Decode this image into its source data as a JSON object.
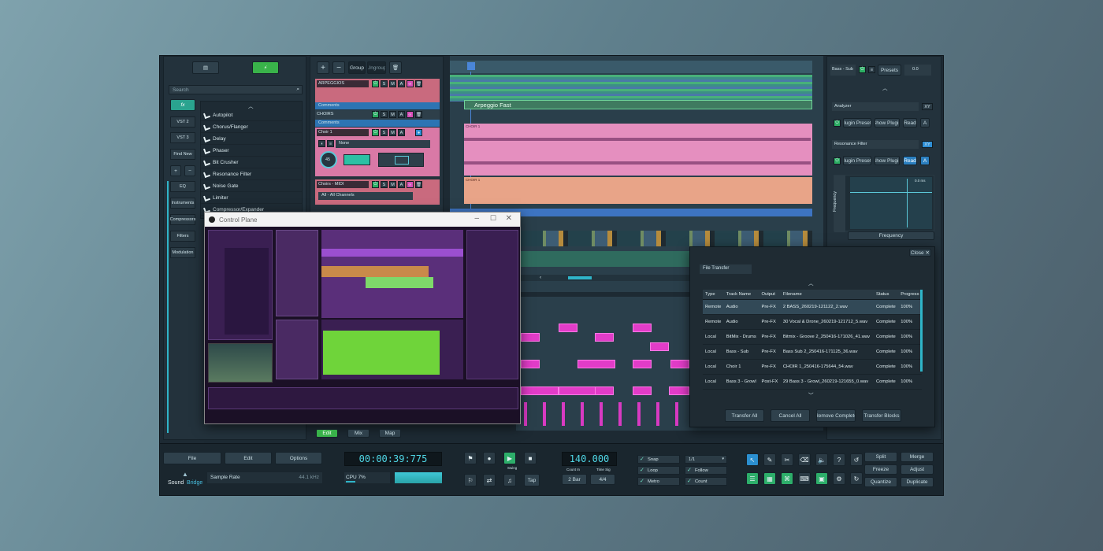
{
  "left_panel": {
    "search_placeholder": "Search",
    "fx_tab": "fx",
    "side_buttons": [
      "VST 2",
      "VST 3",
      "Find New",
      "EQ",
      "Instruments",
      "Compressors",
      "Filters",
      "Modulation"
    ],
    "effects": [
      "Autopilot",
      "Chorus/Flanger",
      "Delay",
      "Phaser",
      "Bit Crusher",
      "Resonance Filter",
      "Noise Gate",
      "Limiter",
      "Compressor/Expander"
    ]
  },
  "tracks": {
    "toolbar": {
      "group": "Group",
      "ungroup": "Ungroup"
    },
    "items": [
      {
        "name": "ARPEGGIOS",
        "comments": "Comments"
      },
      {
        "name": "CHOIRS",
        "comments": "Comments"
      },
      {
        "name": "Choir 1",
        "sub": "None",
        "knob": "45"
      },
      {
        "name": "Choirs - MIDI",
        "sub": "All - All Channels"
      }
    ]
  },
  "arrangement": {
    "clip_arpeggio": "Arpeggio Fast",
    "clip_choir": "CHOIR 1",
    "clip_choir2": "CHOIR 1"
  },
  "control_plane": {
    "title": "Control Plane"
  },
  "right_panel": {
    "track": "Bass - Sub",
    "presets": "Presets",
    "volume": "0.0",
    "plugins": [
      {
        "name": "Analyzer",
        "tag": "XY",
        "presets": "Plugin Presets",
        "show": "Show Plugin",
        "read": "Read",
        "a": "A"
      },
      {
        "name": "Resonance Filter",
        "tag": "XY",
        "presets": "Plugin Presets",
        "show": "Show Plugin",
        "read": "Read",
        "a": "A"
      }
    ],
    "xy": {
      "y_label": "Frequency",
      "x_label": "Frequency",
      "readout": "0.0 ms"
    }
  },
  "file_transfer": {
    "title": "File Transfer",
    "close": "Close",
    "columns": [
      "Type",
      "Track Name",
      "Output",
      "Filename",
      "Status",
      "Progress"
    ],
    "rows": [
      {
        "type": "Remote",
        "track": "Audio",
        "output": "Pre-FX",
        "file": "2 BASS_260219-121122_2.wav",
        "status": "Complete",
        "progress": "100%"
      },
      {
        "type": "Remote",
        "track": "Audio",
        "output": "Pre-FX",
        "file": "30 Vocal & Drone_260219-121712_5.wav",
        "status": "Complete",
        "progress": "100%"
      },
      {
        "type": "Local",
        "track": "BitMix - Drums",
        "output": "Pre-FX",
        "file": "Bitmix - Groove 2_250416-171026_41.wav",
        "status": "Complete",
        "progress": "100%"
      },
      {
        "type": "Local",
        "track": "Bass - Sub",
        "output": "Pre-FX",
        "file": "Bass Sub 2_250416-171125_36.wav",
        "status": "Complete",
        "progress": "100%"
      },
      {
        "type": "Local",
        "track": "Choir 1",
        "output": "Pre-FX",
        "file": "CHOIR 1_250416-175644_54.wav",
        "status": "Complete",
        "progress": "100%"
      },
      {
        "type": "Local",
        "track": "Bass 3 - Growl",
        "output": "Post-FX",
        "file": "29 Bass 3 - Growl_260219-121655_0.wav",
        "status": "Complete",
        "progress": "100%"
      }
    ],
    "buttons": [
      "Transfer All",
      "Cancel All",
      "Remove Complete",
      "Transfer Blocks"
    ]
  },
  "bottom_tabs": [
    "Edit",
    "Mix",
    "Map"
  ],
  "transport": {
    "menu": [
      "File",
      "Edit",
      "Options"
    ],
    "logo_a": "Sound",
    "logo_b": "Bridge",
    "sample_rate_label": "Sample Rate",
    "sample_rate_value": "44.1 kHz",
    "time": "00:00:39:775",
    "cpu": "CPU 7%",
    "tempo": "140.000",
    "count_in_label": "Count In",
    "count_in": "2 Bar",
    "time_sig_label": "Time Sig",
    "time_sig": "4/4",
    "tap": "Tap",
    "swing": "Swing",
    "checks": [
      "Snap",
      "Loop",
      "Metro",
      "Follow",
      "Count"
    ],
    "snap_value": "1/1",
    "actions": [
      "Split",
      "Merge",
      "Freeze",
      "Adjust",
      "Quantize",
      "Duplicate"
    ]
  }
}
